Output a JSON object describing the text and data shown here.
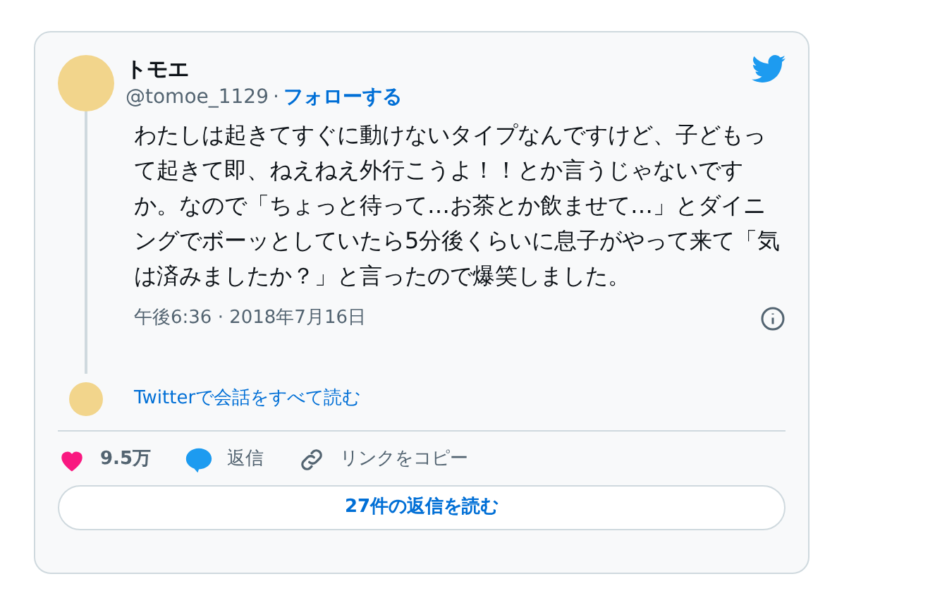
{
  "author": {
    "name": "トモエ",
    "handle": "@tomoe_1129",
    "separator": "·",
    "follow": "フォローする"
  },
  "text": "わたしは起きてすぐに動けないタイプなんですけど、子どもって起きて即、ねえねえ外行こうよ！！とか言うじゃないですか。なので「ちょっと待って…お茶とか飲ませて…」とダイニングでボーッとしていたら5分後くらいに息子がやって来て「気は済みましたか？」と言ったので爆笑しました。",
  "timestamp": "午後6:36 · 2018年7月16日",
  "conversation_link": "Twitterで会話をすべて読む",
  "actions": [
    {
      "kind": "like",
      "label": "9.5万"
    },
    {
      "kind": "reply",
      "label": "返信"
    },
    {
      "kind": "copy",
      "label": "リンクをコピー"
    }
  ],
  "replies_button": "27件の返信を読む"
}
